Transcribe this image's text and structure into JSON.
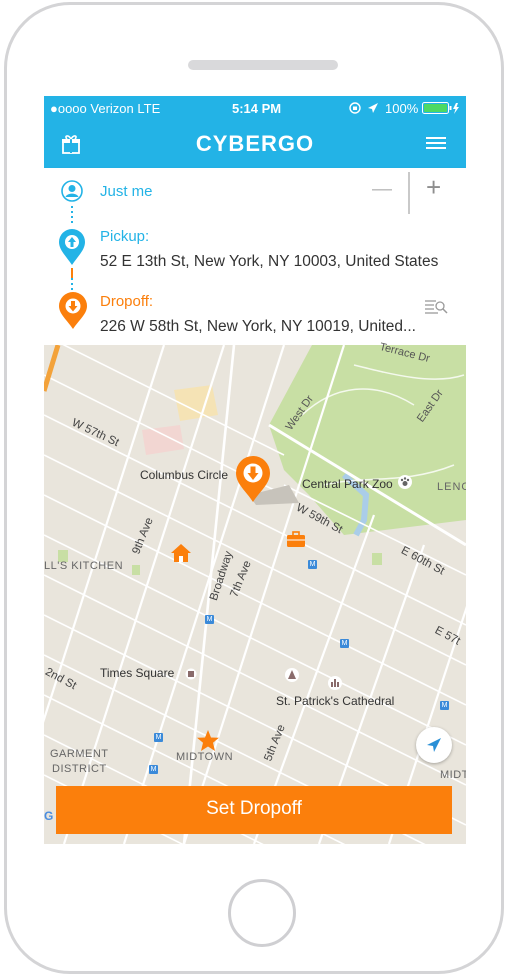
{
  "status_bar": {
    "carrier": "●oooo Verizon  LTE",
    "time": "5:14 PM",
    "battery": "100%"
  },
  "header": {
    "title": "CYBERGO"
  },
  "riders": {
    "label": "Just me",
    "minus_symbol": "—",
    "plus_symbol": "+"
  },
  "pickup": {
    "label": "Pickup:",
    "address": "52 E 13th St, New York, NY  10003, United States"
  },
  "dropoff": {
    "label": "Dropoff:",
    "address": "226 W 58th St, New York, NY  10019, United..."
  },
  "map_labels": {
    "terrace_dr": "Terrace Dr",
    "west_dr": "West Dr",
    "east_dr": "East Dr",
    "w57": "W 57th St",
    "columbus": "Columbus Circle",
    "zoo": "Central Park Zoo",
    "leno": "LENO",
    "w59": "W 59th St",
    "e60": "E 60th St",
    "e57": "E 57t",
    "ninth": "9th Ave",
    "broadway": "Broadway",
    "seventh": "7th Ave",
    "kitchen": "LL'S KITCHEN",
    "times": "Times Square",
    "second": "2nd St",
    "stpat": "St. Patrick's Cathedral",
    "garment1": "GARMENT",
    "garment2": "DISTRICT",
    "midtown": "MIDTOWN",
    "fifth": "5th Ave",
    "midt": "MIDT"
  },
  "action": {
    "set_dropoff_label": "Set Dropoff"
  },
  "colors": {
    "accent_blue": "#23b3e6",
    "accent_orange": "#fb7f0c",
    "park_green": "#c8dfa4"
  }
}
